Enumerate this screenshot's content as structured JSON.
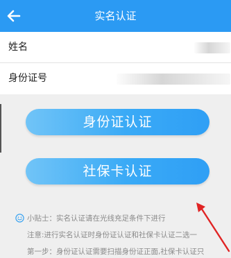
{
  "header": {
    "title": "实名认证",
    "back_icon": "back-arrow-icon",
    "background": "#2b9af3"
  },
  "form": {
    "name_label": "姓名",
    "id_label": "身份证号"
  },
  "buttons": {
    "id_card_auth": "身份证认证",
    "social_card_auth": "社保卡认证"
  },
  "tips": {
    "icon": "smile-icon",
    "line1": "小贴士：实名认证请在光线充足条件下进行",
    "line2": "注意:进行实名认证时身份证认证和社保卡认证二选一",
    "line3": "第一步：身份证认证需要扫描身份证正面,社保卡认证只"
  },
  "annotation": {
    "icon": "red-arrow-icon",
    "color": "#e02424"
  }
}
